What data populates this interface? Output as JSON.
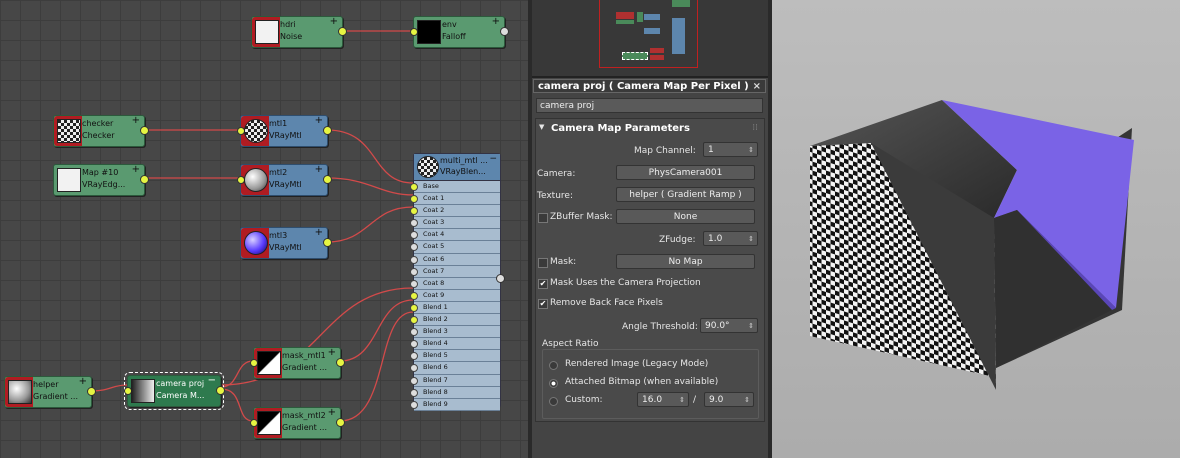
{
  "graph": {
    "nodes": {
      "hdri": {
        "l1": "hdri",
        "l2": "Noise"
      },
      "env": {
        "l1": "env",
        "l2": "Falloff"
      },
      "checker": {
        "l1": "checker",
        "l2": "Checker"
      },
      "mtl1": {
        "l1": "mtl1",
        "l2": "VRayMtl"
      },
      "map10": {
        "l1": "Map #10",
        "l2": "VRayEdg..."
      },
      "mtl2": {
        "l1": "mtl2",
        "l2": "VRayMtl"
      },
      "mtl3": {
        "l1": "mtl3",
        "l2": "VRayMtl"
      },
      "helper": {
        "l1": "helper",
        "l2": "Gradient ..."
      },
      "camproj": {
        "l1": "camera proj",
        "l2": "Camera M..."
      },
      "mask1": {
        "l1": "mask_mtl1",
        "l2": "Gradient ..."
      },
      "mask2": {
        "l1": "mask_mtl2",
        "l2": "Gradient ..."
      }
    },
    "blend": {
      "l1": "multi_mtl ...",
      "l2": "VRayBlen...",
      "slots": [
        "Base",
        "Coat 1",
        "Coat 2",
        "Coat 3",
        "Coat 4",
        "Coat 5",
        "Coat 6",
        "Coat 7",
        "Coat 8",
        "Coat 9",
        "Blend 1",
        "Blend 2",
        "Blend 3",
        "Blend 4",
        "Blend 5",
        "Blend 6",
        "Blend 7",
        "Blend 8",
        "Blend 9"
      ]
    }
  },
  "panel": {
    "title": "camera proj  ( Camera Map Per Pixel  )",
    "close": "×",
    "name_value": "camera proj",
    "rollout_title": "Camera Map Parameters",
    "map_channel_label": "Map Channel:",
    "map_channel_value": "1",
    "camera_label": "Camera:",
    "camera_value": "PhysCamera001",
    "texture_label": "Texture:",
    "texture_value": "helper  ( Gradient Ramp )",
    "zbuffer_label": "ZBuffer Mask:",
    "zbuffer_value": "None",
    "zfudge_label": "ZFudge:",
    "zfudge_value": "1.0",
    "mask_label": "Mask:",
    "mask_value": "No Map",
    "mask_uses_label": "Mask Uses the Camera Projection",
    "remove_back_label": "Remove Back Face Pixels",
    "angle_label": "Angle Threshold:",
    "angle_value": "90.0°",
    "aspect_title": "Aspect Ratio",
    "aspect_rendered": "Rendered Image (Legacy Mode)",
    "aspect_attached": "Attached Bitmap (when available)",
    "aspect_custom": "Custom:",
    "custom_w": "16.0",
    "custom_sep": "/",
    "custom_h": "9.0"
  },
  "checked": {
    "zbuffer": false,
    "mask": false,
    "mask_uses": true,
    "remove_back": true
  },
  "aspect_selected": "attached",
  "colors": {
    "cube_purple": "#7a63e6",
    "node_green": "#5a9a70",
    "node_blue": "#5d86ad",
    "node_red": "#b01c22",
    "wire": "#d24a4a",
    "socket": "#e6f542"
  }
}
